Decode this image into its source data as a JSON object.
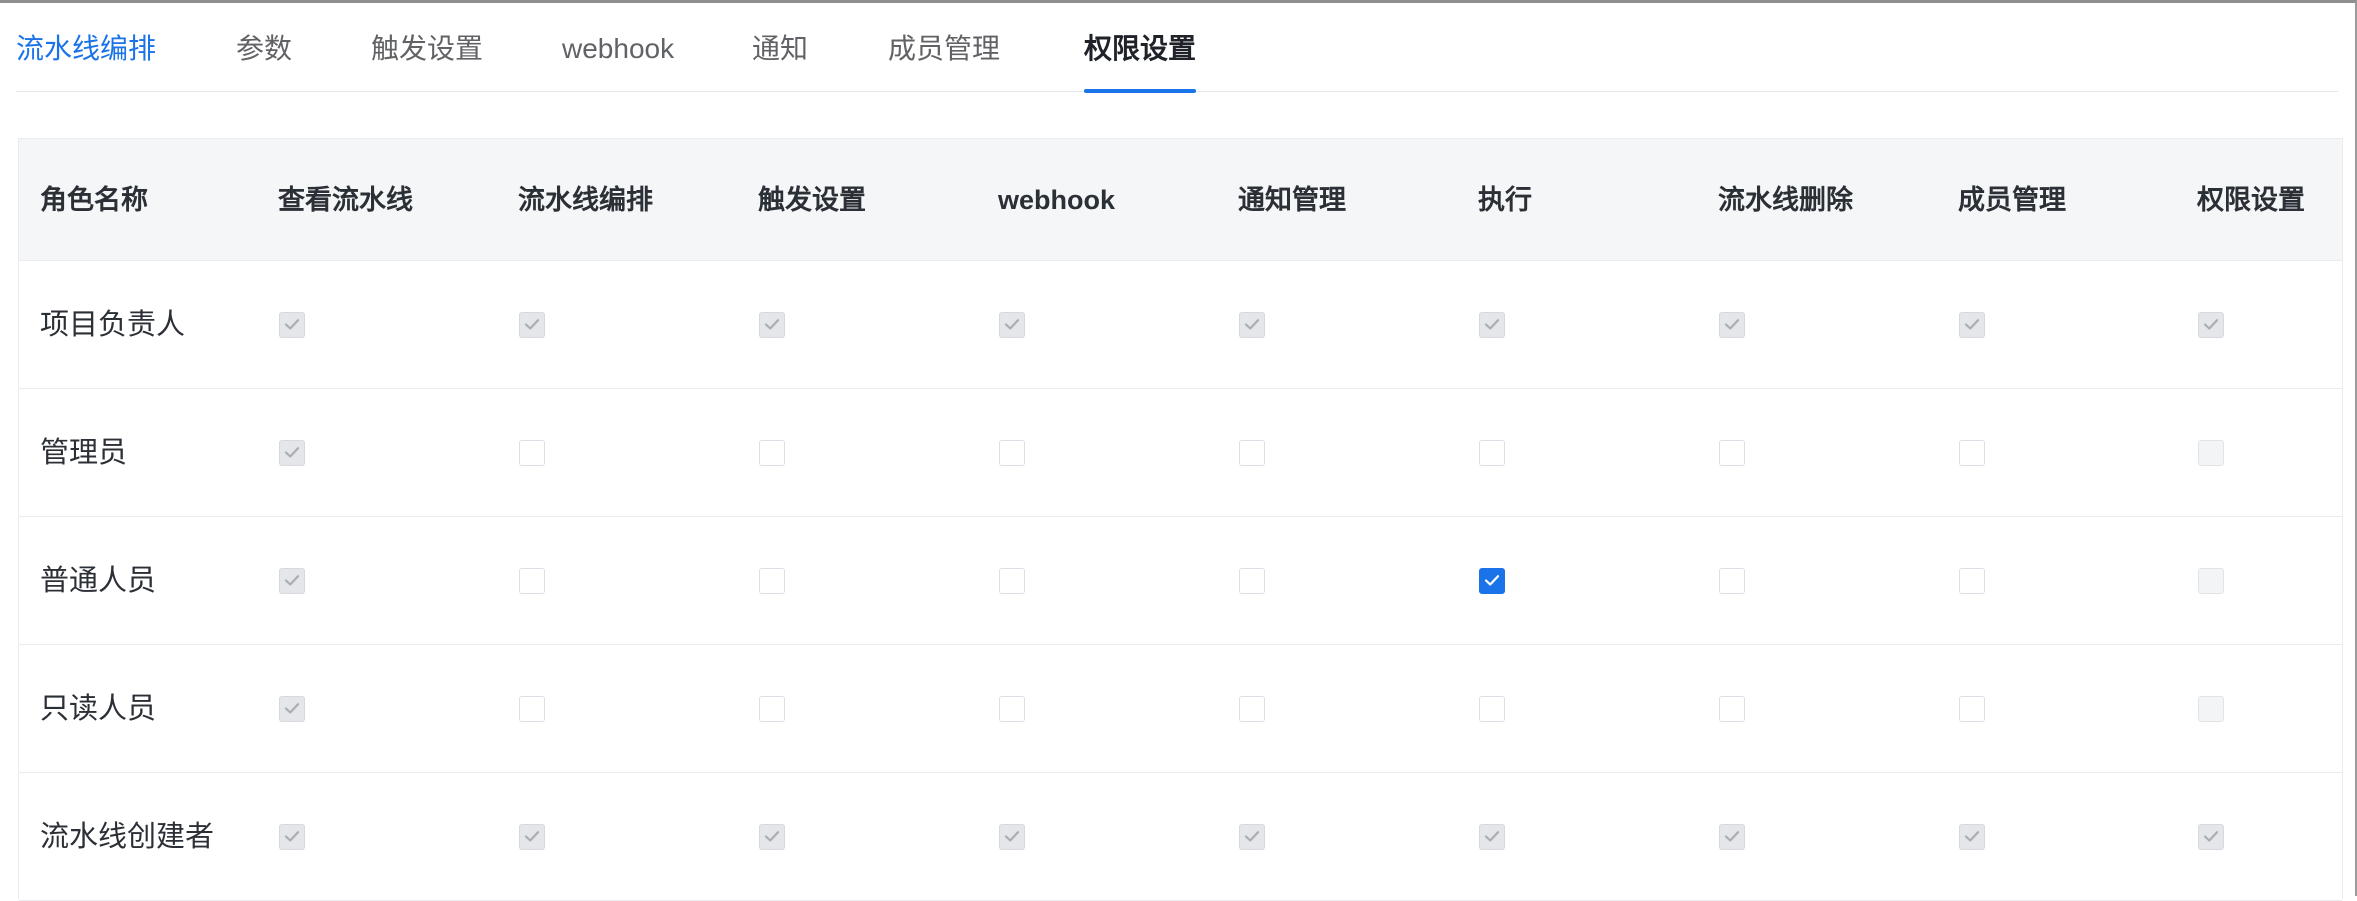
{
  "tabs": [
    {
      "label": "流水线编排",
      "state": "link"
    },
    {
      "label": "参数",
      "state": "normal"
    },
    {
      "label": "触发设置",
      "state": "normal"
    },
    {
      "label": "webhook",
      "state": "normal"
    },
    {
      "label": "通知",
      "state": "normal"
    },
    {
      "label": "成员管理",
      "state": "normal"
    },
    {
      "label": "权限设置",
      "state": "active"
    }
  ],
  "table": {
    "headers": [
      "角色名称",
      "查看流水线",
      "流水线编排",
      "触发设置",
      "webhook",
      "通知管理",
      "执行",
      "流水线删除",
      "成员管理",
      "权限设置"
    ],
    "rows": [
      {
        "role": "项目负责人",
        "perms": [
          "disabled-checked",
          "disabled-checked",
          "disabled-checked",
          "disabled-checked",
          "disabled-checked",
          "disabled-checked",
          "disabled-checked",
          "disabled-checked",
          "disabled-checked"
        ]
      },
      {
        "role": "管理员",
        "perms": [
          "disabled-checked",
          "unchecked",
          "unchecked",
          "unchecked",
          "unchecked",
          "unchecked",
          "unchecked",
          "unchecked",
          "disabled-unchecked"
        ]
      },
      {
        "role": "普通人员",
        "perms": [
          "disabled-checked",
          "unchecked",
          "unchecked",
          "unchecked",
          "unchecked",
          "checked",
          "unchecked",
          "unchecked",
          "disabled-unchecked"
        ]
      },
      {
        "role": "只读人员",
        "perms": [
          "disabled-checked",
          "unchecked",
          "unchecked",
          "unchecked",
          "unchecked",
          "unchecked",
          "unchecked",
          "unchecked",
          "disabled-unchecked"
        ]
      },
      {
        "role": "流水线创建者",
        "perms": [
          "disabled-checked",
          "disabled-checked",
          "disabled-checked",
          "disabled-checked",
          "disabled-checked",
          "disabled-checked",
          "disabled-checked",
          "disabled-checked",
          "disabled-checked"
        ]
      }
    ]
  },
  "colors": {
    "accent": "#1a73e8",
    "header_bg": "#f5f6f7",
    "border": "#e9ebee"
  },
  "icons": {
    "check": "check-icon"
  }
}
